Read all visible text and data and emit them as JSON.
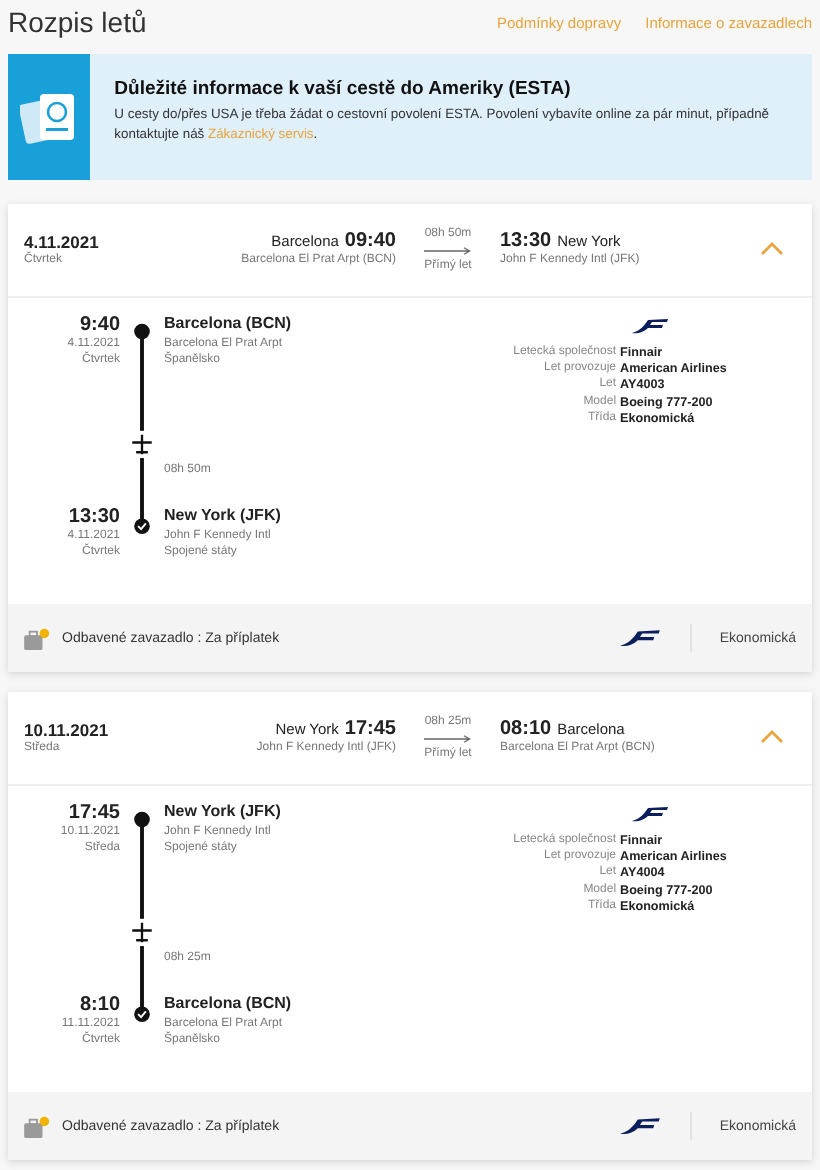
{
  "title": "Rozpis letů",
  "links": [
    "Podmínky dopravy",
    "Informace o zavazadlech"
  ],
  "notice": {
    "title": "Důležité informace k vaší cestě do Ameriky (ESTA)",
    "text": "U cesty do/přes USA je třeba žádat o cestovní povolení ESTA. Povolení vybavíte online za pár minut, případně kontaktujte náš",
    "link": "Zákaznický servis",
    "after": "."
  },
  "flights": [
    {
      "date": "4.11.2021",
      "weekday": "Čtvrtek",
      "from_city": "Barcelona",
      "dep_time": "09:40",
      "from_airport": "Barcelona El Prat Arpt (BCN)",
      "duration": "08h 50m",
      "direct": "Přímý let",
      "arr_time": "13:30",
      "to_city": "New York",
      "to_airport": "John F Kennedy Intl (JFK)",
      "expanded": true,
      "departure": {
        "time": "9:40",
        "date": "4.11.2021",
        "weekday": "Čtvrtek",
        "place": "Barcelona (BCN)",
        "airport": "Barcelona El Prat Arpt",
        "country": "Španělsko"
      },
      "leg_duration": "08h 50m",
      "arrival": {
        "time": "13:30",
        "date": "4.11.2021",
        "weekday": "Čtvrtek",
        "place": "New York (JFK)",
        "airport": "John F Kennedy Intl",
        "country": "Spojené státy"
      },
      "details": [
        {
          "label": "Letecká společnost",
          "value": "Finnair"
        },
        {
          "label": "Let provozuje",
          "value": "American Airlines"
        },
        {
          "label": "Let",
          "value": "AY4003"
        },
        {
          "label": "Model",
          "value": "Boeing 777-200"
        },
        {
          "label": "Třída",
          "value": "Ekonomická"
        }
      ],
      "baggage": "Odbavené zavazadlo : Za příplatek",
      "cabin": "Ekonomická"
    },
    {
      "date": "10.11.2021",
      "weekday": "Středa",
      "from_city": "New York",
      "dep_time": "17:45",
      "from_airport": "John F Kennedy Intl (JFK)",
      "duration": "08h 25m",
      "direct": "Přímý let",
      "arr_time": "08:10",
      "to_city": "Barcelona",
      "to_airport": "Barcelona El Prat Arpt (BCN)",
      "expanded": true,
      "departure": {
        "time": "17:45",
        "date": "10.11.2021",
        "weekday": "Středa",
        "place": "New York (JFK)",
        "airport": "John F Kennedy Intl",
        "country": "Spojené státy"
      },
      "leg_duration": "08h 25m",
      "arrival": {
        "time": "8:10",
        "date": "11.11.2021",
        "weekday": "Čtvrtek",
        "place": "Barcelona (BCN)",
        "airport": "Barcelona El Prat Arpt",
        "country": "Španělsko"
      },
      "details": [
        {
          "label": "Letecká společnost",
          "value": "Finnair"
        },
        {
          "label": "Let provozuje",
          "value": "American Airlines"
        },
        {
          "label": "Let",
          "value": "AY4004"
        },
        {
          "label": "Model",
          "value": "Boeing 777-200"
        },
        {
          "label": "Třída",
          "value": "Ekonomická"
        }
      ],
      "baggage": "Odbavené zavazadlo : Za příplatek",
      "cabin": "Ekonomická"
    }
  ]
}
